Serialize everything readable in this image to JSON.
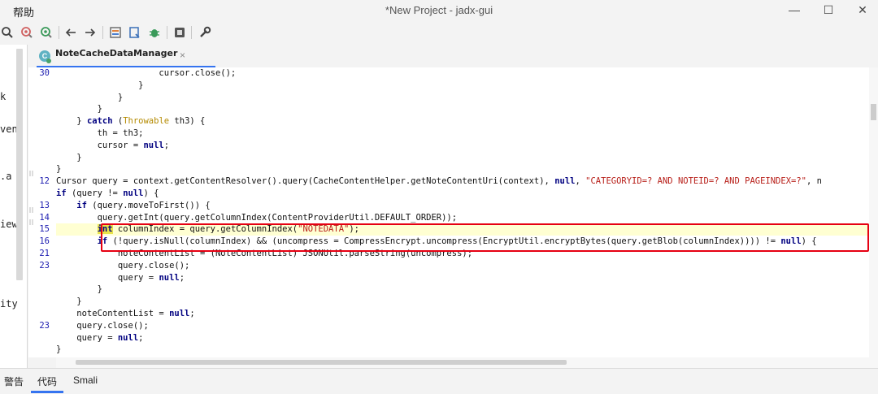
{
  "window": {
    "menu_label": "帮助",
    "title": "*New Project - jadx-gui"
  },
  "toolbar": {
    "icons": [
      "search-icon",
      "find-usage-icon",
      "find-class-icon",
      "back-icon",
      "forward-icon",
      "sync-icon",
      "decompile-icon",
      "debug-icon",
      "log-icon",
      "settings-icon"
    ]
  },
  "left_panel": {
    "fragments": [
      "k",
      "ven",
      ".a",
      "iew",
      "ity"
    ]
  },
  "editor": {
    "tab_label": "NoteCacheDataManager",
    "tab_icon_letter": "C",
    "tab_close": "×",
    "lines": [
      {
        "num": "30",
        "parts": [
          {
            "t": "                    cursor.close();"
          }
        ]
      },
      {
        "num": "",
        "parts": [
          {
            "t": "                }"
          }
        ]
      },
      {
        "num": "",
        "parts": [
          {
            "t": "            }"
          }
        ]
      },
      {
        "num": "",
        "parts": [
          {
            "t": "        }"
          }
        ]
      },
      {
        "num": "",
        "parts": [
          {
            "t": "    } "
          },
          {
            "t": "catch",
            "c": "kw"
          },
          {
            "t": " ("
          },
          {
            "t": "Throwable",
            "c": "typ"
          },
          {
            "t": " th3) {"
          }
        ]
      },
      {
        "num": "",
        "parts": [
          {
            "t": "        th = th3;"
          }
        ]
      },
      {
        "num": "",
        "parts": [
          {
            "t": "        cursor = "
          },
          {
            "t": "null",
            "c": "kw"
          },
          {
            "t": ";"
          }
        ]
      },
      {
        "num": "",
        "parts": [
          {
            "t": "    }"
          }
        ]
      },
      {
        "num": "",
        "parts": [
          {
            "t": "}"
          }
        ]
      },
      {
        "num": "12",
        "parts": [
          {
            "t": "Cursor query = context.getContentResolver().query(CacheContentHelper.getNoteContentUri(context), "
          },
          {
            "t": "null",
            "c": "kw"
          },
          {
            "t": ", "
          },
          {
            "t": "\"CATEGORYID=? AND NOTEID=? AND PAGEINDEX=?\"",
            "c": "str"
          },
          {
            "t": ", n"
          }
        ]
      },
      {
        "num": "",
        "parts": [
          {
            "t": "if",
            "c": "kw"
          },
          {
            "t": " (query != "
          },
          {
            "t": "null",
            "c": "kw"
          },
          {
            "t": ") {"
          }
        ]
      },
      {
        "num": "13",
        "parts": [
          {
            "t": "    "
          },
          {
            "t": "if",
            "c": "kw"
          },
          {
            "t": " (query.moveToFirst()) {"
          }
        ]
      },
      {
        "num": "14",
        "parts": [
          {
            "t": "        query.getInt(query.getColumnIndex(ContentProviderUtil.DEFAULT_ORDER));"
          }
        ]
      },
      {
        "num": "15",
        "hl": true,
        "parts": [
          {
            "t": "        "
          },
          {
            "t": "int",
            "c": "kw hl-word"
          },
          {
            "t": " columnIndex = query.getColumnIndex("
          },
          {
            "t": "\"NOTEDATA\"",
            "c": "str"
          },
          {
            "t": ");"
          }
        ]
      },
      {
        "num": "16",
        "parts": [
          {
            "t": "        "
          },
          {
            "t": "if",
            "c": "kw"
          },
          {
            "t": " (!query.isNull(columnIndex) && (uncompress = CompressEncrypt.uncompress(EncryptUtil.encryptBytes(query.getBlob(columnIndex)))) != "
          },
          {
            "t": "null",
            "c": "kw"
          },
          {
            "t": ") {"
          }
        ]
      },
      {
        "num": "21",
        "parts": [
          {
            "t": "            noteContentList = (NoteContentList) JSONUtil.parseString(uncompress);"
          }
        ]
      },
      {
        "num": "23",
        "parts": [
          {
            "t": "            query.close();"
          }
        ]
      },
      {
        "num": "",
        "parts": [
          {
            "t": "            query = "
          },
          {
            "t": "null",
            "c": "kw"
          },
          {
            "t": ";"
          }
        ]
      },
      {
        "num": "",
        "parts": [
          {
            "t": "        }"
          }
        ]
      },
      {
        "num": "",
        "parts": [
          {
            "t": "    }"
          }
        ]
      },
      {
        "num": "",
        "parts": [
          {
            "t": "    noteContentList = "
          },
          {
            "t": "null",
            "c": "kw"
          },
          {
            "t": ";"
          }
        ]
      },
      {
        "num": "23",
        "parts": [
          {
            "t": "    query.close();"
          }
        ]
      },
      {
        "num": "",
        "parts": [
          {
            "t": "    query = "
          },
          {
            "t": "null",
            "c": "kw"
          },
          {
            "t": ";"
          }
        ]
      },
      {
        "num": "",
        "parts": [
          {
            "t": "}"
          }
        ]
      }
    ]
  },
  "bottom_tabs": [
    "警告",
    "代码",
    "Smali"
  ],
  "colors": {
    "accent": "#3574f0",
    "keyword": "#000080",
    "string": "#b8201a",
    "highlight_box": "#e60012",
    "line_number": "#1c1cb0"
  }
}
